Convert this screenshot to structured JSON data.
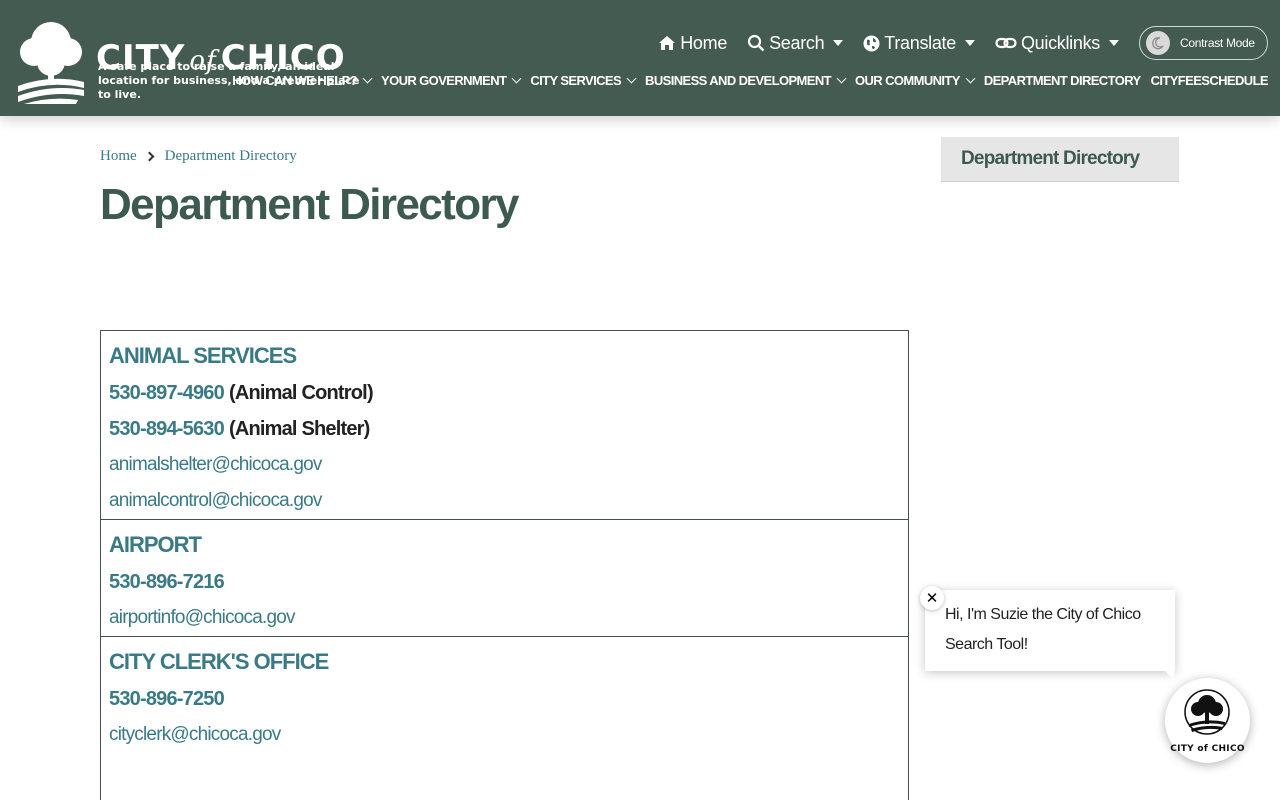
{
  "header": {
    "logo": {
      "title_left": "CITY",
      "title_of": "of",
      "title_right": "CHICO",
      "tagline": "A safe place to raise a family, an ideal location for business, and a premier place to live."
    },
    "utility_nav": [
      {
        "label": "Home",
        "icon": "home-icon"
      },
      {
        "label": "Search",
        "icon": "search-icon"
      },
      {
        "label": "Translate",
        "icon": "globe-icon"
      },
      {
        "label": "Quicklinks",
        "icon": "link-icon"
      }
    ],
    "contrast_mode_label": "Contrast Mode",
    "main_nav": [
      {
        "label": "HOW CAN WE HELP?"
      },
      {
        "label": "YOUR GOVERNMENT"
      },
      {
        "label": "CITY SERVICES"
      },
      {
        "label": "BUSINESS AND DEVELOPMENT"
      },
      {
        "label": "OUR COMMUNITY"
      },
      {
        "label": "DEPARTMENT DIRECTORY"
      },
      {
        "label": "CITYFEESCHEDULE"
      }
    ]
  },
  "breadcrumb": {
    "home": "Home",
    "current": "Department Directory"
  },
  "page_title": "Department Directory",
  "sidebar": {
    "title": "Department Directory"
  },
  "departments": [
    {
      "name": "ANIMAL SERVICES",
      "phones": [
        {
          "number": "530-897-4960",
          "note": "(Animal Control)"
        },
        {
          "number": "530-894-5630",
          "note": "(Animal Shelter)"
        }
      ],
      "emails": [
        "animalshelter@chicoca.gov",
        "animalcontrol@chicoca.gov"
      ]
    },
    {
      "name": "AIRPORT",
      "phones": [
        {
          "number": "530-896-7216",
          "note": ""
        }
      ],
      "emails": [
        "airportinfo@chicoca.gov"
      ]
    },
    {
      "name": "CITY CLERK'S OFFICE",
      "phones": [
        {
          "number": "530-896-7250",
          "note": ""
        }
      ],
      "emails": [
        "cityclerk@chicoca.gov"
      ]
    }
  ],
  "chat": {
    "message": "Hi, I'm Suzie the City of Chico Search Tool!",
    "close_symbol": "✕",
    "avatar_label": "CITY of CHICO"
  },
  "colors": {
    "header_bg": "#445b52",
    "link": "#3a7a86",
    "title": "#3d5a50"
  }
}
